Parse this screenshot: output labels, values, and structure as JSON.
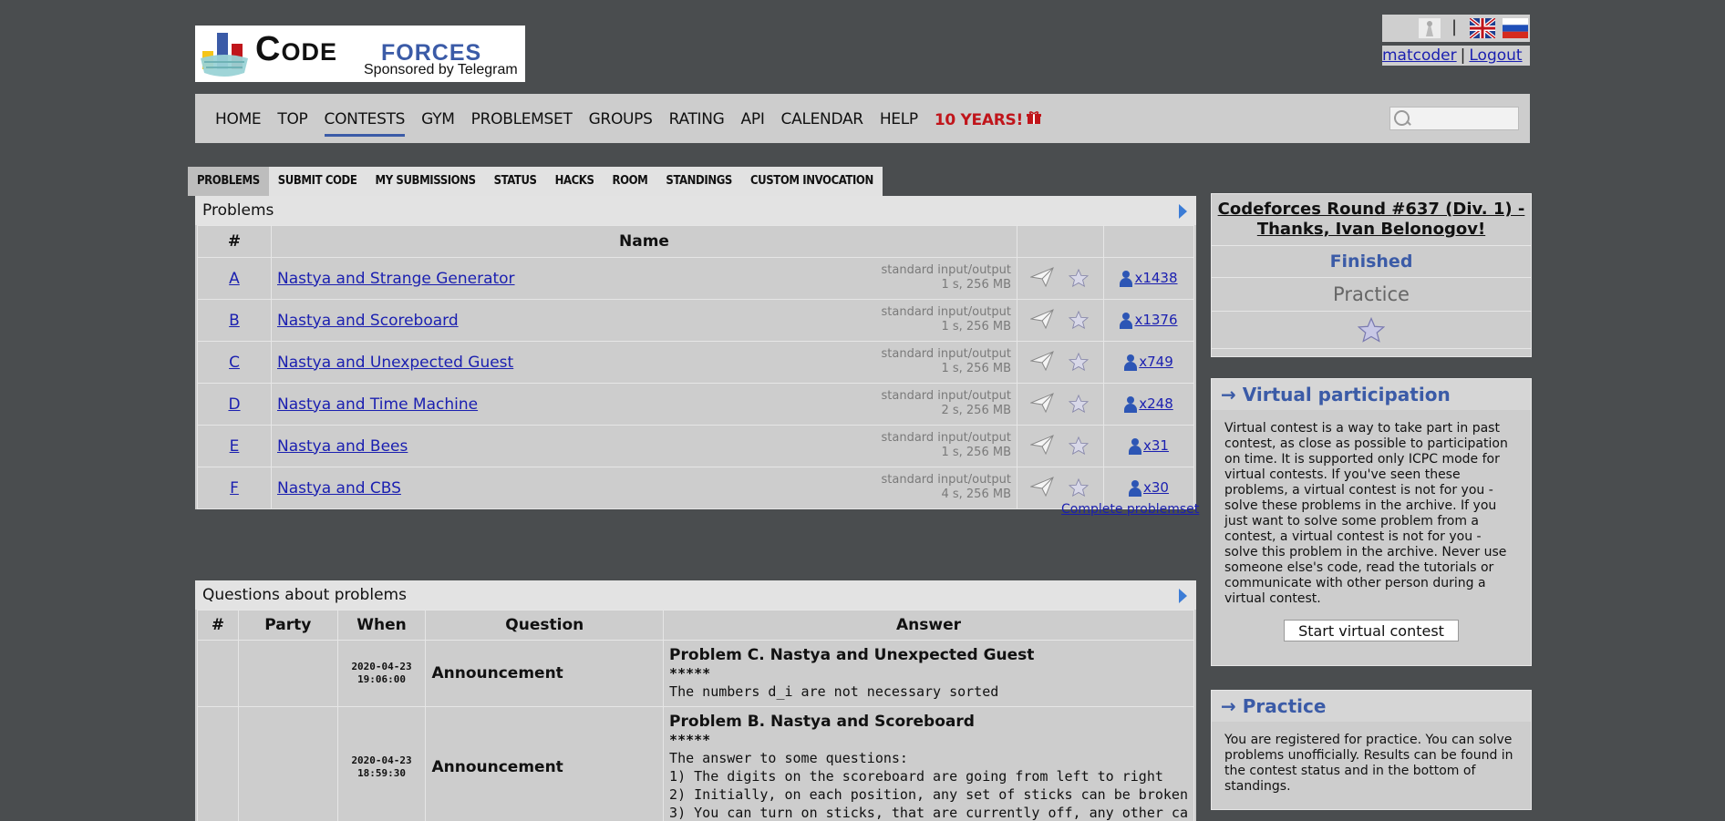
{
  "logo": {
    "code": "Code",
    "forces": "forces",
    "sponsor": "Sponsored by Telegram"
  },
  "header": {
    "lang_sep": "|",
    "user": "matcoder",
    "user_sep": "|",
    "logout": "Logout"
  },
  "menu": {
    "items": [
      "HOME",
      "TOP",
      "CONTESTS",
      "GYM",
      "PROBLEMSET",
      "GROUPS",
      "RATING",
      "API",
      "CALENDAR",
      "HELP"
    ],
    "special": "10 YEARS!",
    "active": "CONTESTS"
  },
  "contest_tabs": [
    "PROBLEMS",
    "SUBMIT CODE",
    "MY SUBMISSIONS",
    "STATUS",
    "HACKS",
    "ROOM",
    "STANDINGS",
    "CUSTOM INVOCATION"
  ],
  "problems": {
    "title": "Problems",
    "col_index": "#",
    "col_name": "Name",
    "rows": [
      {
        "idx": "A",
        "name": "Nastya and Strange Generator",
        "io": "standard input/output",
        "limits": "1 s, 256 MB",
        "solved": "x1438"
      },
      {
        "idx": "B",
        "name": "Nastya and Scoreboard",
        "io": "standard input/output",
        "limits": "1 s, 256 MB",
        "solved": "x1376"
      },
      {
        "idx": "C",
        "name": "Nastya and Unexpected Guest",
        "io": "standard input/output",
        "limits": "1 s, 256 MB",
        "solved": "x749"
      },
      {
        "idx": "D",
        "name": "Nastya and Time Machine",
        "io": "standard input/output",
        "limits": "2 s, 256 MB",
        "solved": "x248"
      },
      {
        "idx": "E",
        "name": "Nastya and Bees",
        "io": "standard input/output",
        "limits": "1 s, 256 MB",
        "solved": "x31"
      },
      {
        "idx": "F",
        "name": "Nastya and CBS",
        "io": "standard input/output",
        "limits": "4 s, 256 MB",
        "solved": "x30"
      }
    ],
    "complete_link": "Complete problemset"
  },
  "questions": {
    "title": "Questions about problems",
    "cols": [
      "#",
      "Party",
      "When",
      "Question",
      "Answer"
    ],
    "rows": [
      {
        "date": "2020-04-23",
        "time": "19:06:00",
        "question": "Announcement",
        "answer_title": "Problem C. Nastya and Unexpected Guest",
        "stars": "*****",
        "lines": [
          "The numbers d_i are not necessary sorted"
        ]
      },
      {
        "date": "2020-04-23",
        "time": "18:59:30",
        "question": "Announcement",
        "answer_title": "Problem B. Nastya and Scoreboard",
        "stars": "*****",
        "lines": [
          "The answer to some questions:",
          "1) The digits on the scoreboard are going from left to right",
          "2) Initially, on each position, any set of sticks can be broken",
          "3) You can turn on sticks, that are currently off, any other ca"
        ]
      }
    ]
  },
  "sidebar": {
    "contest_title": "Codeforces Round #637 (Div. 1) - Thanks, Ivan Belonogov!",
    "status": "Finished",
    "phase": "Practice",
    "virtual": {
      "heading": "→ Virtual participation",
      "text": "Virtual contest is a way to take part in past contest, as close as possible to participation on time. It is supported only ICPC mode for virtual contests. If you've seen these problems, a virtual contest is not for you - solve these problems in the archive. If you just want to solve some problem from a contest, a virtual contest is not for you - solve this problem in the archive. Never use someone else's code, read the tutorials or communicate with other person during a virtual contest.",
      "button": "Start virtual contest"
    },
    "practice": {
      "heading": "→ Practice",
      "text": "You are registered for practice. You can solve problems unofficially. Results can be found in the contest status and in the bottom of standings."
    }
  },
  "colors": {
    "accent": "#3b5ba7",
    "link": "#1a1fb0",
    "special": "#c0151b",
    "background": "#4a4d4f"
  },
  "icons": [
    "search-icon",
    "send-icon",
    "star-icon",
    "person-icon",
    "uk-flag-icon",
    "ru-flag-icon",
    "gift-icon",
    "play-arrow-icon"
  ]
}
